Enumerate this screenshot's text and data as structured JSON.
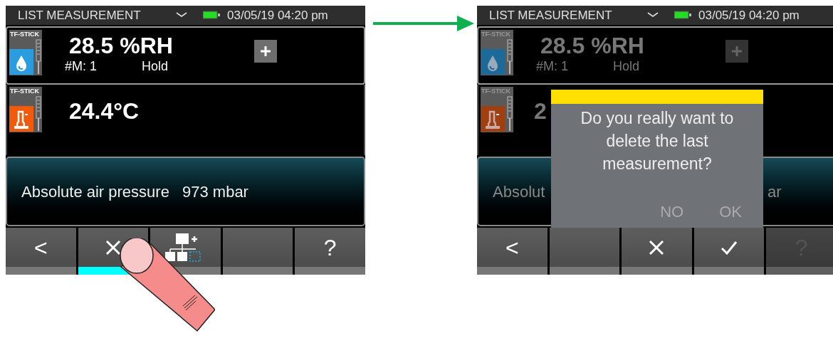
{
  "screens": [
    {
      "dimmed": false,
      "header": {
        "title": "LIST MEASUREMENT",
        "datetime": "03/05/19 04:20 pm"
      },
      "sensors": [
        {
          "kind": "humidity",
          "badge": "TF-STICK",
          "value": "28.5 %RH",
          "count": "#M: 1",
          "status": "Hold",
          "framed": true
        },
        {
          "kind": "temperature",
          "badge": "TF-STICK",
          "value": "24.4°C",
          "framed": false
        }
      ],
      "info": {
        "label": "Absolute air pressure",
        "value": "973 mbar"
      },
      "softkeys": [
        {
          "kind": "text",
          "label": "<",
          "selected": false,
          "disabled": false
        },
        {
          "kind": "delete",
          "selected": true,
          "disabled": false
        },
        {
          "kind": "tree",
          "selected": false,
          "disabled": false
        },
        {
          "kind": "empty",
          "selected": false,
          "disabled": false
        },
        {
          "kind": "text",
          "label": "?",
          "selected": false,
          "disabled": false
        }
      ]
    },
    {
      "dimmed": true,
      "header": {
        "title": "LIST MEASUREMENT",
        "datetime": "03/05/19 04:20 pm"
      },
      "sensors": [
        {
          "kind": "humidity",
          "badge": "TF-STICK",
          "value": "28.5 %RH",
          "count": "#M: 1",
          "status": "Hold",
          "framed": true
        },
        {
          "kind": "temperature",
          "badge": "TF-STICK",
          "value": "2",
          "framed": false
        }
      ],
      "info": {
        "label": "Absolut",
        "value": "ar"
      },
      "dialog": {
        "message": "Do you really want to delete the last measurement?",
        "buttons": [
          "NO",
          "OK"
        ]
      },
      "softkeys": [
        {
          "kind": "text",
          "label": "<",
          "selected": false,
          "disabled": false
        },
        {
          "kind": "empty",
          "selected": false,
          "disabled": false
        },
        {
          "kind": "delete",
          "selected": false,
          "disabled": false
        },
        {
          "kind": "confirm",
          "selected": false,
          "disabled": false
        },
        {
          "kind": "text",
          "label": "?",
          "selected": false,
          "disabled": true
        }
      ]
    }
  ]
}
